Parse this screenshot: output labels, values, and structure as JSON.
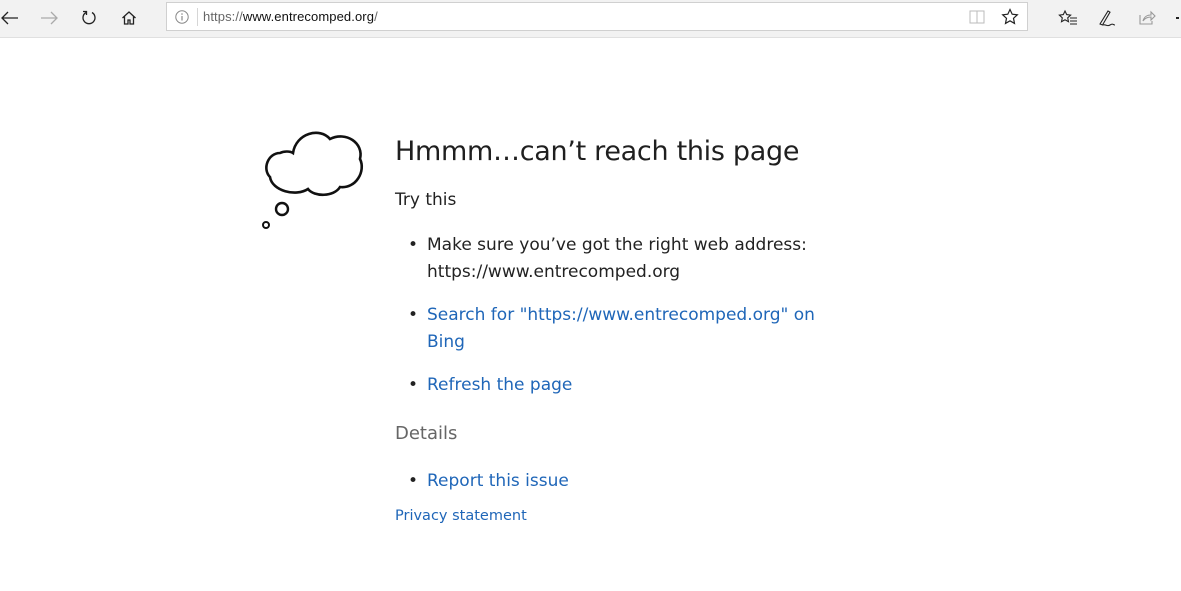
{
  "browser": {
    "back_label": "Back",
    "forward_label": "Forward",
    "refresh_label": "Refresh",
    "home_label": "Home",
    "url_prefix": "https://",
    "url_host": "www.entrecomped.org",
    "url_suffix": "/",
    "icons": [
      "back-arrow-icon",
      "forward-arrow-icon",
      "refresh-icon",
      "home-icon",
      "info-icon",
      "reading-view-icon",
      "favorite-star-icon",
      "favorites-list-icon",
      "pen-icon",
      "share-icon"
    ]
  },
  "error": {
    "title": "Hmmm…can’t reach this page",
    "try_this": "Try this",
    "suggestions": [
      {
        "text": "Make sure you’ve got the right web address: https://www.entrecomped.org",
        "link": false
      },
      {
        "text": "Search for \"https://www.entrecomped.org\" on Bing",
        "link": true
      },
      {
        "text": "Refresh the page",
        "link": true
      }
    ],
    "details_label": "Details",
    "details_items": [
      {
        "text": "Report this issue",
        "link": true
      }
    ],
    "privacy": "Privacy statement"
  },
  "colors": {
    "link": "#1f66b8",
    "text": "#222222",
    "muted": "#666666",
    "toolbar": "#f2f2f2"
  }
}
